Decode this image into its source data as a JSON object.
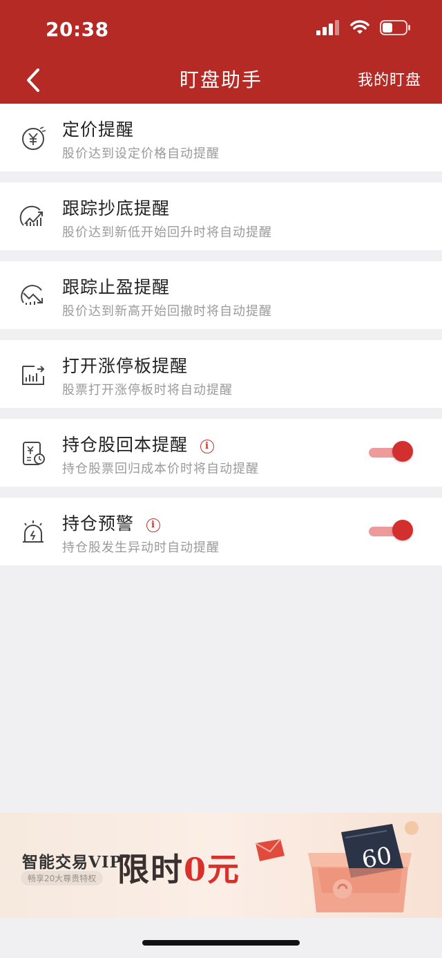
{
  "status_bar": {
    "time": "20:38"
  },
  "nav": {
    "title": "盯盘助手",
    "right_label": "我的盯盘"
  },
  "items": [
    {
      "title": "定价提醒",
      "desc": "股价达到设定价格自动提醒",
      "icon": "yen-price-icon"
    },
    {
      "title": "跟踪抄底提醒",
      "desc": "股价达到新低开始回升时将自动提醒",
      "icon": "chart-rise-icon"
    },
    {
      "title": "跟踪止盈提醒",
      "desc": "股价达到新高开始回撤时将自动提醒",
      "icon": "chart-fall-icon"
    },
    {
      "title": "打开涨停板提醒",
      "desc": "股票打开涨停板时将自动提醒",
      "icon": "limit-up-board-icon"
    },
    {
      "title": "持仓股回本提醒",
      "desc": "持仓股票回归成本价时将自动提醒",
      "icon": "holding-cost-icon",
      "toggle_on": true
    },
    {
      "title": "持仓预警",
      "desc": "持仓股发生异动时自动提醒",
      "icon": "alarm-bell-icon",
      "toggle_on": true
    }
  ],
  "banner": {
    "vip_text": "智能交易VIP",
    "sub_text": "畅享20大尊贵特权",
    "big_text_dark": "限时",
    "big_text_red": "0元",
    "coupon_value": "60"
  },
  "colors": {
    "brand_red": "#b52a24",
    "toggle_knob": "#d32f2f",
    "toggle_track": "#ef9a9a"
  }
}
